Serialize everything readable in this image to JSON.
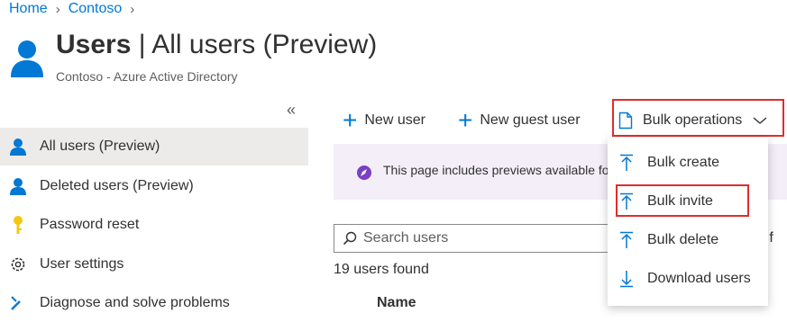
{
  "breadcrumb": {
    "items": [
      "Home",
      "Contoso"
    ]
  },
  "header": {
    "title_bold": "Users",
    "title_rest": " | All users (Preview)",
    "subtitle": "Contoso - Azure Active Directory"
  },
  "sidebar": {
    "collapse_glyph": "«",
    "items": [
      {
        "label": "All users (Preview)",
        "icon": "user-icon",
        "active": true
      },
      {
        "label": "Deleted users (Preview)",
        "icon": "user-icon",
        "active": false
      },
      {
        "label": "Password reset",
        "icon": "key-icon",
        "active": false
      },
      {
        "label": "User settings",
        "icon": "gear-icon",
        "active": false
      },
      {
        "label": "Diagnose and solve problems",
        "icon": "wrench-icon",
        "active": false
      }
    ]
  },
  "toolbar": {
    "new_user": "New user",
    "new_guest_user": "New guest user",
    "bulk_operations": "Bulk operations"
  },
  "banner": {
    "text": "This page includes previews available for your evaluation. View"
  },
  "search": {
    "placeholder": "Search users"
  },
  "filter_fragment": "d f",
  "results": {
    "count_text": "19 users found",
    "column_name": "Name"
  },
  "bulk_menu": {
    "items": [
      {
        "label": "Bulk create",
        "icon": "upload-icon"
      },
      {
        "label": "Bulk invite",
        "icon": "upload-icon"
      },
      {
        "label": "Bulk delete",
        "icon": "upload-icon"
      },
      {
        "label": "Download users",
        "icon": "download-icon"
      }
    ]
  },
  "colors": {
    "accent": "#0078d4",
    "highlight": "#e02d2d",
    "banner_bg": "#f3eef8",
    "active_nav": "#edebe9"
  }
}
